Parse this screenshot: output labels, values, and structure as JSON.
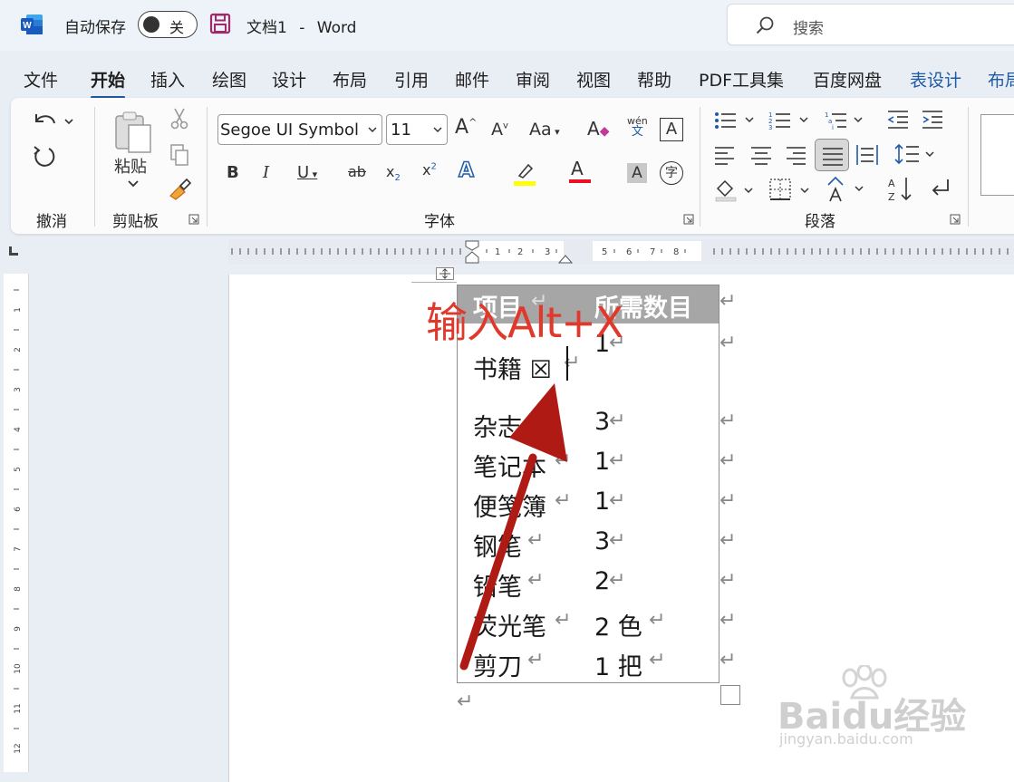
{
  "titlebar": {
    "autosave_label": "自动保存",
    "autosave_state": "关",
    "doc_name": "文档1",
    "separator": "-",
    "app_name": "Word",
    "search_placeholder": "搜索"
  },
  "tabs": [
    "文件",
    "开始",
    "插入",
    "绘图",
    "设计",
    "布局",
    "引用",
    "邮件",
    "审阅",
    "视图",
    "帮助",
    "PDF工具集",
    "百度网盘",
    "表设计",
    "布局"
  ],
  "active_tab": "开始",
  "ribbon": {
    "groups": {
      "undo": "撤消",
      "clipboard": "剪贴板",
      "font": "字体",
      "paragraph": "段落"
    },
    "paste_label": "粘贴",
    "font_name": "Segoe UI Symbol",
    "font_size": "11",
    "wen_top": "wén",
    "wen_bottom": "文",
    "zi": "字"
  },
  "document": {
    "table_headers": [
      "项目",
      "所需数目"
    ],
    "rows": [
      {
        "item": "书籍 ☒",
        "qty": "1"
      },
      {
        "item": "杂志",
        "qty": "3"
      },
      {
        "item": "笔记本",
        "qty": "1"
      },
      {
        "item": "便笺簿",
        "qty": "1"
      },
      {
        "item": "钢笔",
        "qty": "3"
      },
      {
        "item": "铅笔",
        "qty": "2"
      },
      {
        "item": "荧光笔",
        "qty": "2  色"
      },
      {
        "item": "剪刀",
        "qty": "1  把"
      }
    ],
    "paragraph_mark": "↵"
  },
  "annotation": {
    "text": "输入Alt+X",
    "color": "#e0392b"
  },
  "watermark": {
    "brand": "Baidu经验",
    "url": "jingyan.baidu.com"
  },
  "colors": {
    "accent": "#1f5aa6",
    "header_fill": "#a6a6a6"
  }
}
